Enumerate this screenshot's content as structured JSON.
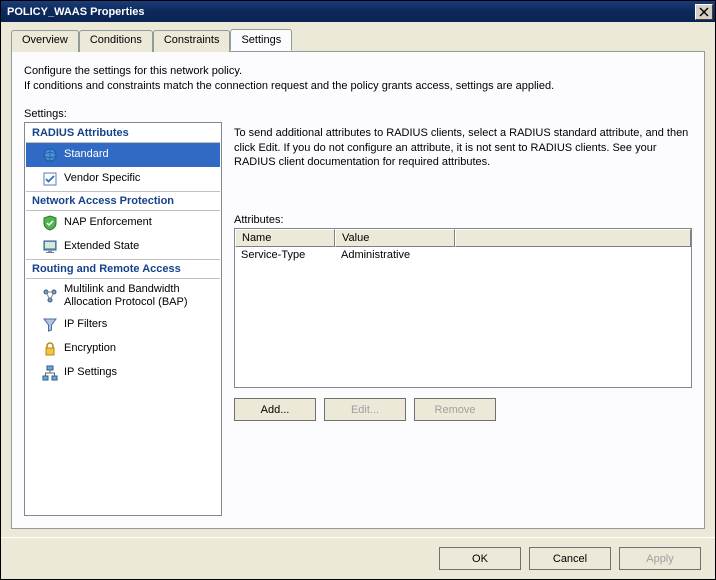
{
  "window": {
    "title": "POLICY_WAAS Properties"
  },
  "tabs": {
    "overview": "Overview",
    "conditions": "Conditions",
    "constraints": "Constraints",
    "settings": "Settings"
  },
  "intro": {
    "line1": "Configure the settings for this network policy.",
    "line2": "If conditions and constraints match the connection request and the policy grants access, settings are applied."
  },
  "settings_label": "Settings:",
  "sidebar": {
    "cat_radius": "RADIUS Attributes",
    "items_radius": [
      {
        "label": "Standard",
        "selected": true
      },
      {
        "label": "Vendor Specific",
        "selected": false
      }
    ],
    "cat_nap": "Network Access Protection",
    "items_nap": [
      {
        "label": "NAP Enforcement"
      },
      {
        "label": "Extended State"
      }
    ],
    "cat_rras": "Routing and Remote Access",
    "items_rras": [
      {
        "label": "Multilink and Bandwidth Allocation Protocol (BAP)"
      },
      {
        "label": "IP Filters"
      },
      {
        "label": "Encryption"
      },
      {
        "label": "IP Settings"
      }
    ]
  },
  "detail": {
    "desc": "To send additional attributes to RADIUS clients, select a RADIUS standard attribute, and then click Edit. If you do not configure an attribute, it is not sent to RADIUS clients. See your RADIUS client documentation for required attributes.",
    "attributes_label": "Attributes:",
    "columns": {
      "name": "Name",
      "value": "Value"
    },
    "rows": [
      {
        "name": "Service-Type",
        "value": "Administrative"
      }
    ],
    "buttons": {
      "add": "Add...",
      "edit": "Edit...",
      "remove": "Remove"
    }
  },
  "footer": {
    "ok": "OK",
    "cancel": "Cancel",
    "apply": "Apply"
  }
}
